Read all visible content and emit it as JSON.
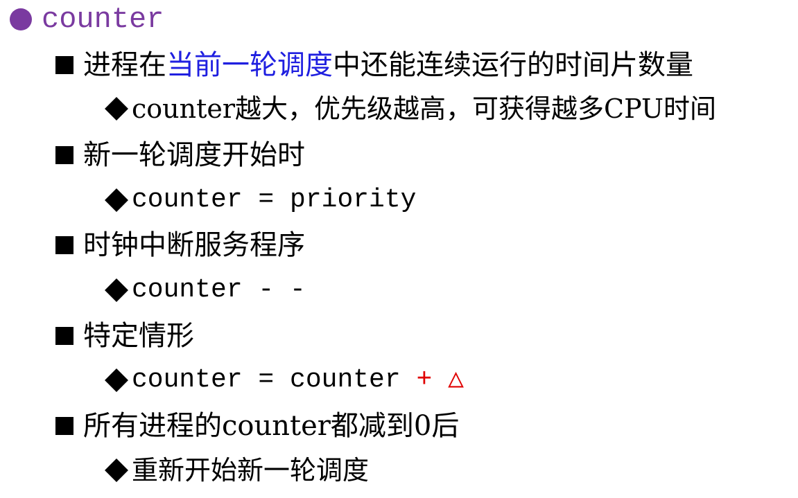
{
  "heading": {
    "text": "counter",
    "bullet_color": "#7a3aa0"
  },
  "items": [
    {
      "text_before": "进程在",
      "highlight": "当前一轮调度",
      "text_after": "中还能连续运行的时间片数量",
      "sub": "counter越大，优先级越高，可获得越多CPU时间"
    },
    {
      "text": "新一轮调度开始时",
      "sub": "counter = priority"
    },
    {
      "text": "时钟中断服务程序",
      "sub": "counter - -"
    },
    {
      "text": "特定情形",
      "sub_prefix": "counter = counter ",
      "sub_red": "+ △"
    },
    {
      "text": "所有进程的counter都减到0后",
      "sub": "重新开始新一轮调度"
    }
  ],
  "colors": {
    "highlight": "#1f1fe0",
    "delta": "#e00000"
  }
}
